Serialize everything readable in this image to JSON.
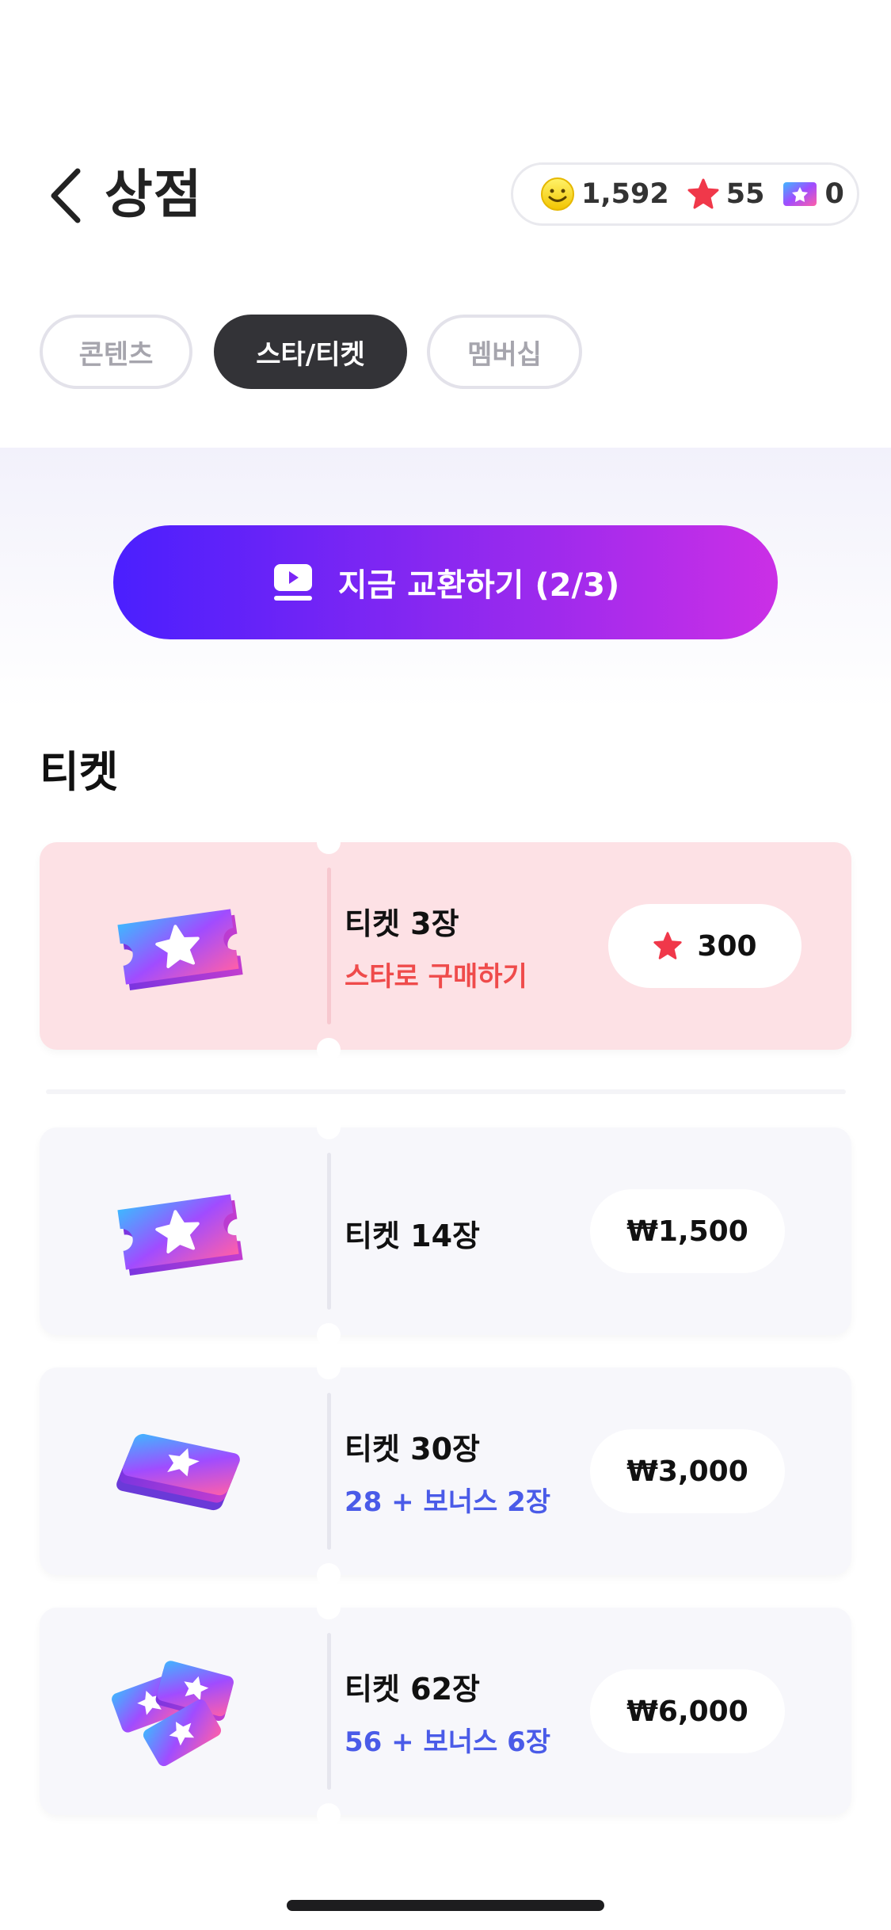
{
  "header": {
    "title": "상점",
    "balances": [
      {
        "icon": "smiley-coin-icon",
        "value": "1,592"
      },
      {
        "icon": "star-icon",
        "value": "55"
      },
      {
        "icon": "ticket-icon",
        "value": "0"
      }
    ]
  },
  "tabs": [
    {
      "label": "콘텐츠",
      "active": false
    },
    {
      "label": "스타/티켓",
      "active": true
    },
    {
      "label": "멤버십",
      "active": false
    }
  ],
  "exchange_button": {
    "label": "지금 교환하기 (2/3)",
    "icon": "play-screen-icon"
  },
  "section_title": "티켓",
  "tickets": [
    {
      "name": "티켓 3장",
      "sub": "스타로 구매하기",
      "price": "300",
      "price_icon": "star-icon",
      "highlight": true
    },
    {
      "name": "티켓 14장",
      "sub": "",
      "price": "₩1,500",
      "highlight": false
    },
    {
      "name": "티켓 30장",
      "sub": "28 + 보너스 2장",
      "price": "₩3,000",
      "highlight": false
    },
    {
      "name": "티켓 62장",
      "sub": "56 + 보너스 6장",
      "price": "₩6,000",
      "highlight": false
    }
  ],
  "colors": {
    "accent_gradient_start": "#4a1ffe",
    "accent_gradient_end": "#cb2fe6",
    "star_red": "#f0384a",
    "bonus_blue": "#4a5be8",
    "star_sub_red": "#ef4b4b"
  }
}
